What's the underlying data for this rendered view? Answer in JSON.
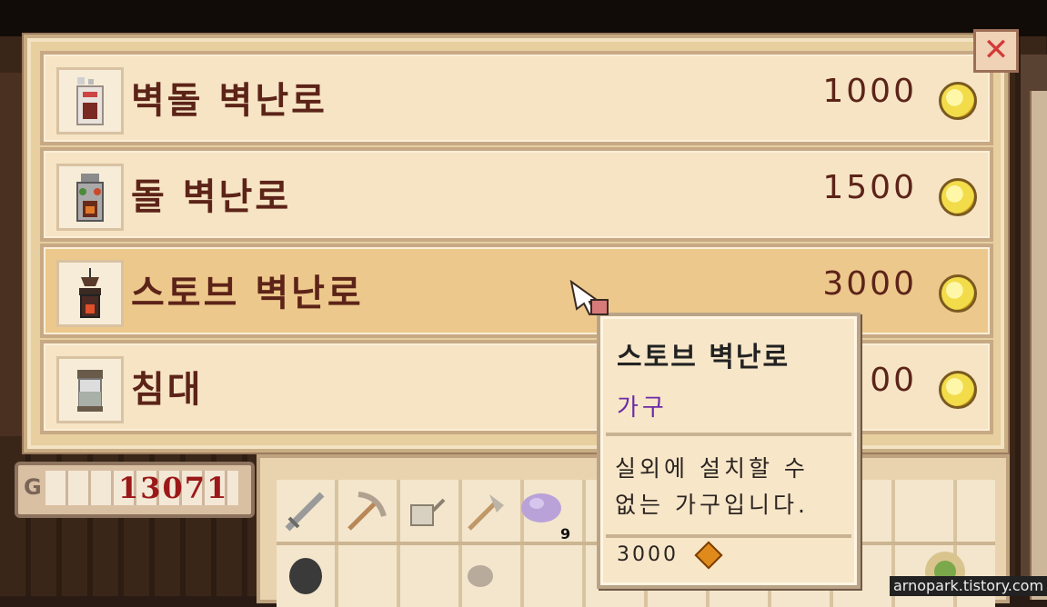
{
  "shop": {
    "items": [
      {
        "name": "벽돌 벽난로",
        "price": "1000",
        "icon": "brick-fireplace-icon",
        "selected": false
      },
      {
        "name": "돌 벽난로",
        "price": "1500",
        "icon": "stone-fireplace-icon",
        "selected": false
      },
      {
        "name": "스토브 벽난로",
        "price": "3000",
        "icon": "stove-fireplace-icon",
        "selected": true
      },
      {
        "name": "침대",
        "price": "00",
        "icon": "bed-icon",
        "selected": false
      }
    ],
    "close_icon": "close-icon"
  },
  "money": {
    "label": "G",
    "value": "13071"
  },
  "inventory": {
    "tools": [
      "sword-icon",
      "pickaxe-icon",
      "watering-can-icon",
      "axe-icon",
      "amethyst-icon"
    ],
    "counts": [
      "9"
    ]
  },
  "tooltip": {
    "title": "스토브 벽난로",
    "category": "가구",
    "description": "실외에 설치할 수 없는 가구입니다.",
    "price": "3000"
  },
  "watermark": "arnopark.tistory.com",
  "colors": {
    "selected_row": "#edc88c",
    "row": "#f6e4c4",
    "text": "#5c2318",
    "category": "#6b2aa6",
    "money": "#9b1818"
  }
}
